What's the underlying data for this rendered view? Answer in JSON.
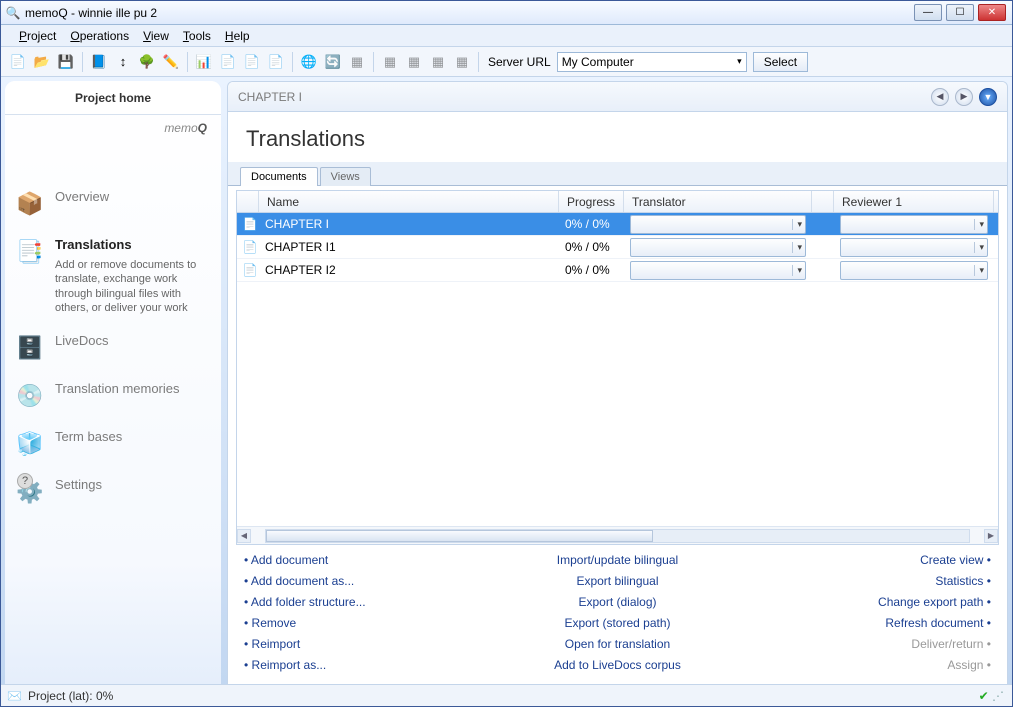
{
  "window": {
    "title": "memoQ - winnie ille pu 2"
  },
  "menu": {
    "project": "Project",
    "operations": "Operations",
    "view": "View",
    "tools": "Tools",
    "help": "Help"
  },
  "toolbar": {
    "server_url_label": "Server URL",
    "server_value": "My Computer",
    "select_label": "Select"
  },
  "sidebar": {
    "tab": "Project home",
    "logo": "memo",
    "items": [
      {
        "title": "Overview"
      },
      {
        "title": "Translations",
        "desc": "Add or remove documents to translate, exchange work through bilingual files with others, or deliver your work"
      },
      {
        "title": "LiveDocs"
      },
      {
        "title": "Translation memories"
      },
      {
        "title": "Term bases"
      },
      {
        "title": "Settings"
      }
    ]
  },
  "main": {
    "doc_tab": "CHAPTER I",
    "title": "Translations",
    "subtabs": {
      "documents": "Documents",
      "views": "Views"
    },
    "columns": {
      "name": "Name",
      "progress": "Progress",
      "translator": "Translator",
      "reviewer": "Reviewer 1"
    },
    "rows": [
      {
        "name": "CHAPTER I",
        "progress": "0% / 0%"
      },
      {
        "name": "CHAPTER I1",
        "progress": "0% / 0%"
      },
      {
        "name": "CHAPTER I2",
        "progress": "0% / 0%"
      }
    ],
    "actions_left": [
      "Add document",
      "Add document as...",
      "Add folder structure...",
      "Remove",
      "Reimport",
      "Reimport as..."
    ],
    "actions_center": [
      "Import/update bilingual",
      "Export bilingual",
      "Export (dialog)",
      "Export (stored path)",
      "Open for translation",
      "Add to LiveDocs corpus"
    ],
    "actions_right": [
      {
        "label": "Create view",
        "disabled": false
      },
      {
        "label": "Statistics",
        "disabled": false
      },
      {
        "label": "Change export path",
        "disabled": false
      },
      {
        "label": "Refresh document",
        "disabled": false
      },
      {
        "label": "Deliver/return",
        "disabled": true
      },
      {
        "label": "Assign",
        "disabled": true
      }
    ]
  },
  "status": {
    "text": "Project (lat): 0%"
  }
}
